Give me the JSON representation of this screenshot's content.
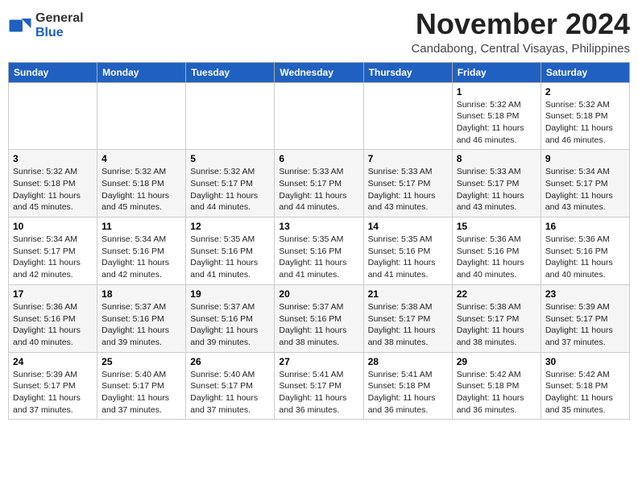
{
  "header": {
    "logo_line1": "General",
    "logo_line2": "Blue",
    "month": "November 2024",
    "location": "Candabong, Central Visayas, Philippines"
  },
  "weekdays": [
    "Sunday",
    "Monday",
    "Tuesday",
    "Wednesday",
    "Thursday",
    "Friday",
    "Saturday"
  ],
  "weeks": [
    [
      {
        "day": "",
        "info": ""
      },
      {
        "day": "",
        "info": ""
      },
      {
        "day": "",
        "info": ""
      },
      {
        "day": "",
        "info": ""
      },
      {
        "day": "",
        "info": ""
      },
      {
        "day": "1",
        "info": "Sunrise: 5:32 AM\nSunset: 5:18 PM\nDaylight: 11 hours\nand 46 minutes."
      },
      {
        "day": "2",
        "info": "Sunrise: 5:32 AM\nSunset: 5:18 PM\nDaylight: 11 hours\nand 46 minutes."
      }
    ],
    [
      {
        "day": "3",
        "info": "Sunrise: 5:32 AM\nSunset: 5:18 PM\nDaylight: 11 hours\nand 45 minutes."
      },
      {
        "day": "4",
        "info": "Sunrise: 5:32 AM\nSunset: 5:18 PM\nDaylight: 11 hours\nand 45 minutes."
      },
      {
        "day": "5",
        "info": "Sunrise: 5:32 AM\nSunset: 5:17 PM\nDaylight: 11 hours\nand 44 minutes."
      },
      {
        "day": "6",
        "info": "Sunrise: 5:33 AM\nSunset: 5:17 PM\nDaylight: 11 hours\nand 44 minutes."
      },
      {
        "day": "7",
        "info": "Sunrise: 5:33 AM\nSunset: 5:17 PM\nDaylight: 11 hours\nand 43 minutes."
      },
      {
        "day": "8",
        "info": "Sunrise: 5:33 AM\nSunset: 5:17 PM\nDaylight: 11 hours\nand 43 minutes."
      },
      {
        "day": "9",
        "info": "Sunrise: 5:34 AM\nSunset: 5:17 PM\nDaylight: 11 hours\nand 43 minutes."
      }
    ],
    [
      {
        "day": "10",
        "info": "Sunrise: 5:34 AM\nSunset: 5:17 PM\nDaylight: 11 hours\nand 42 minutes."
      },
      {
        "day": "11",
        "info": "Sunrise: 5:34 AM\nSunset: 5:16 PM\nDaylight: 11 hours\nand 42 minutes."
      },
      {
        "day": "12",
        "info": "Sunrise: 5:35 AM\nSunset: 5:16 PM\nDaylight: 11 hours\nand 41 minutes."
      },
      {
        "day": "13",
        "info": "Sunrise: 5:35 AM\nSunset: 5:16 PM\nDaylight: 11 hours\nand 41 minutes."
      },
      {
        "day": "14",
        "info": "Sunrise: 5:35 AM\nSunset: 5:16 PM\nDaylight: 11 hours\nand 41 minutes."
      },
      {
        "day": "15",
        "info": "Sunrise: 5:36 AM\nSunset: 5:16 PM\nDaylight: 11 hours\nand 40 minutes."
      },
      {
        "day": "16",
        "info": "Sunrise: 5:36 AM\nSunset: 5:16 PM\nDaylight: 11 hours\nand 40 minutes."
      }
    ],
    [
      {
        "day": "17",
        "info": "Sunrise: 5:36 AM\nSunset: 5:16 PM\nDaylight: 11 hours\nand 40 minutes."
      },
      {
        "day": "18",
        "info": "Sunrise: 5:37 AM\nSunset: 5:16 PM\nDaylight: 11 hours\nand 39 minutes."
      },
      {
        "day": "19",
        "info": "Sunrise: 5:37 AM\nSunset: 5:16 PM\nDaylight: 11 hours\nand 39 minutes."
      },
      {
        "day": "20",
        "info": "Sunrise: 5:37 AM\nSunset: 5:16 PM\nDaylight: 11 hours\nand 38 minutes."
      },
      {
        "day": "21",
        "info": "Sunrise: 5:38 AM\nSunset: 5:17 PM\nDaylight: 11 hours\nand 38 minutes."
      },
      {
        "day": "22",
        "info": "Sunrise: 5:38 AM\nSunset: 5:17 PM\nDaylight: 11 hours\nand 38 minutes."
      },
      {
        "day": "23",
        "info": "Sunrise: 5:39 AM\nSunset: 5:17 PM\nDaylight: 11 hours\nand 37 minutes."
      }
    ],
    [
      {
        "day": "24",
        "info": "Sunrise: 5:39 AM\nSunset: 5:17 PM\nDaylight: 11 hours\nand 37 minutes."
      },
      {
        "day": "25",
        "info": "Sunrise: 5:40 AM\nSunset: 5:17 PM\nDaylight: 11 hours\nand 37 minutes."
      },
      {
        "day": "26",
        "info": "Sunrise: 5:40 AM\nSunset: 5:17 PM\nDaylight: 11 hours\nand 37 minutes."
      },
      {
        "day": "27",
        "info": "Sunrise: 5:41 AM\nSunset: 5:17 PM\nDaylight: 11 hours\nand 36 minutes."
      },
      {
        "day": "28",
        "info": "Sunrise: 5:41 AM\nSunset: 5:18 PM\nDaylight: 11 hours\nand 36 minutes."
      },
      {
        "day": "29",
        "info": "Sunrise: 5:42 AM\nSunset: 5:18 PM\nDaylight: 11 hours\nand 36 minutes."
      },
      {
        "day": "30",
        "info": "Sunrise: 5:42 AM\nSunset: 5:18 PM\nDaylight: 11 hours\nand 35 minutes."
      }
    ]
  ]
}
